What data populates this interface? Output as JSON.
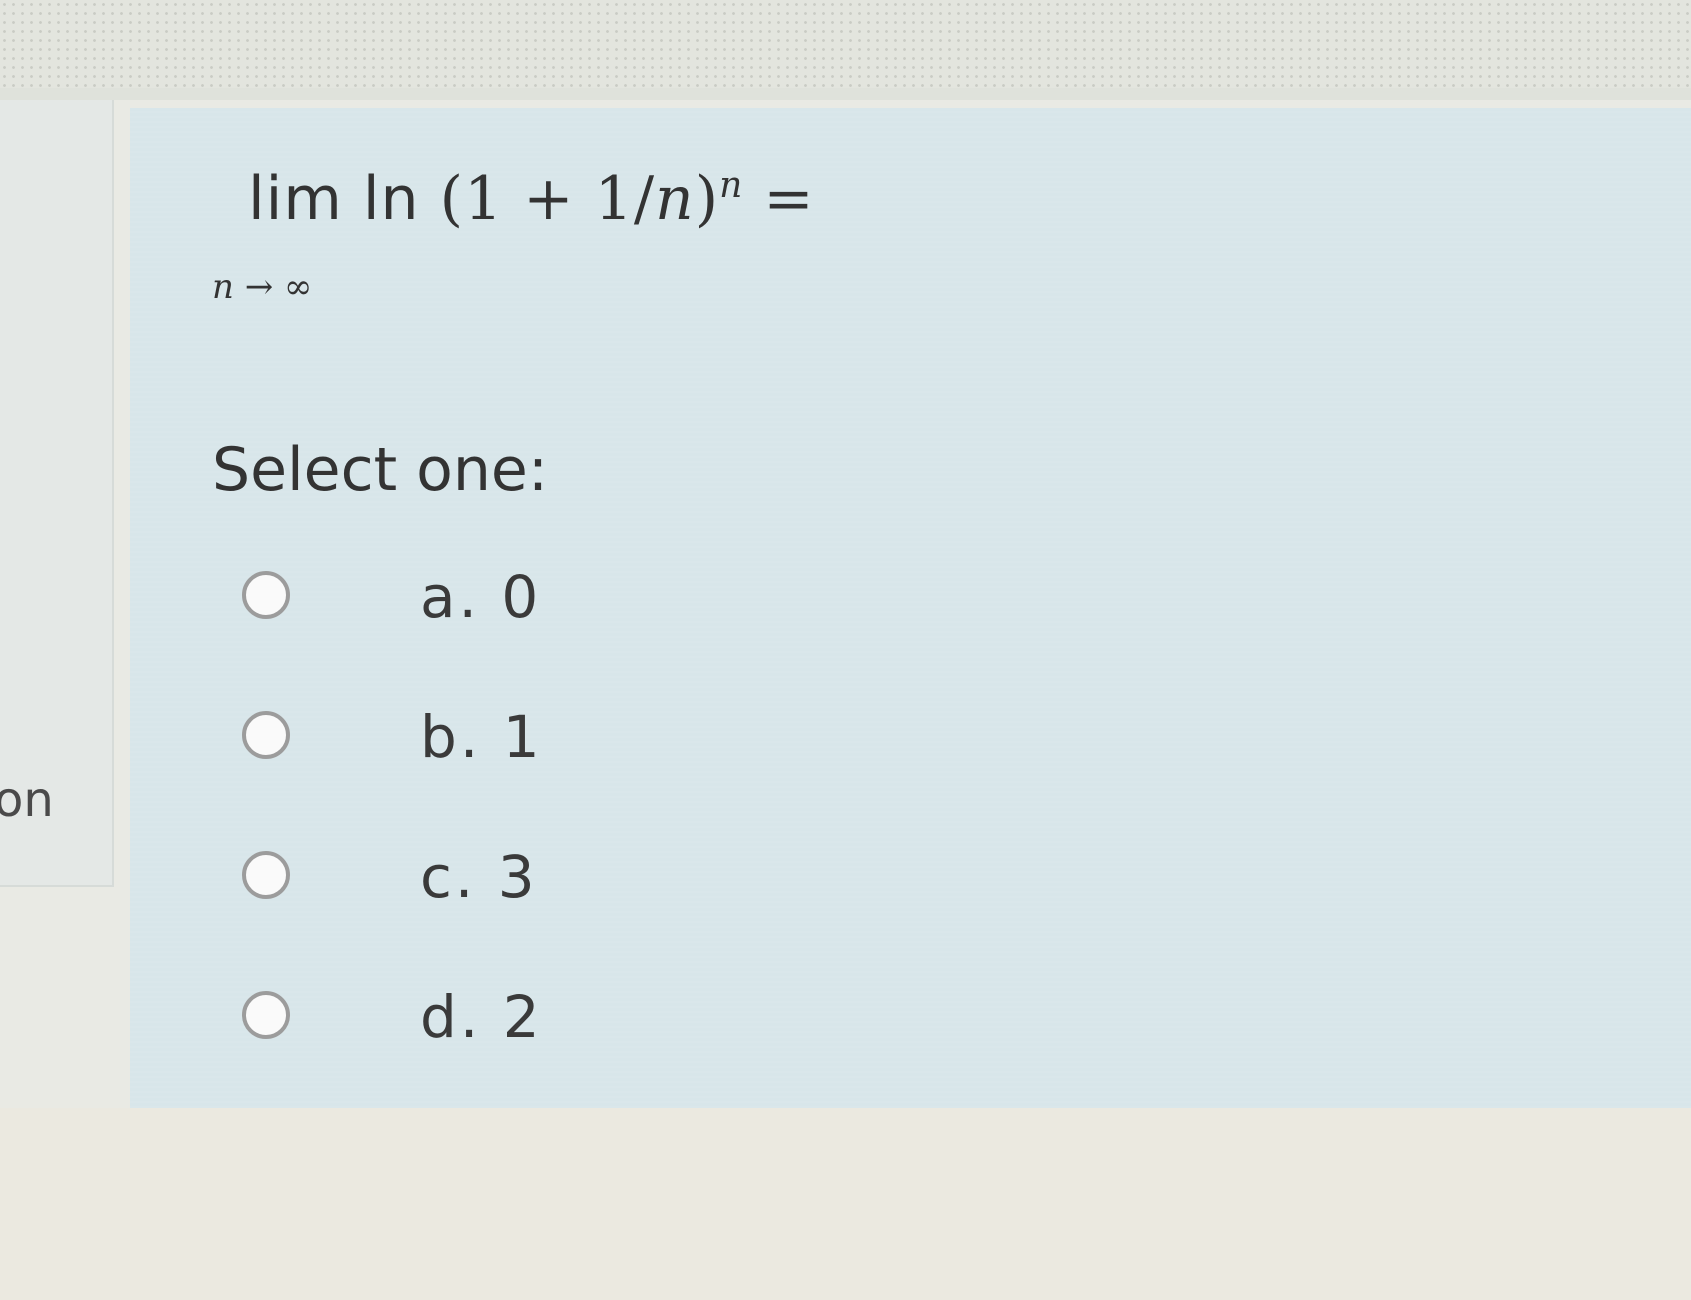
{
  "sidebar": {
    "fragment_text": "on"
  },
  "question": {
    "lim_text": "lim",
    "ln_text": "ln",
    "expression_open": "(1 + 1/",
    "expression_var": "n",
    "expression_close": ")",
    "exponent": "n",
    "equals": "=",
    "subscript_var": "n",
    "subscript_rest": "→ ∞"
  },
  "prompt": "Select one:",
  "options": [
    {
      "label": "a. 0",
      "selected": false
    },
    {
      "label": "b. 1",
      "selected": false
    },
    {
      "label": "c. 3",
      "selected": false
    },
    {
      "label": "d. 2",
      "selected": false
    }
  ]
}
